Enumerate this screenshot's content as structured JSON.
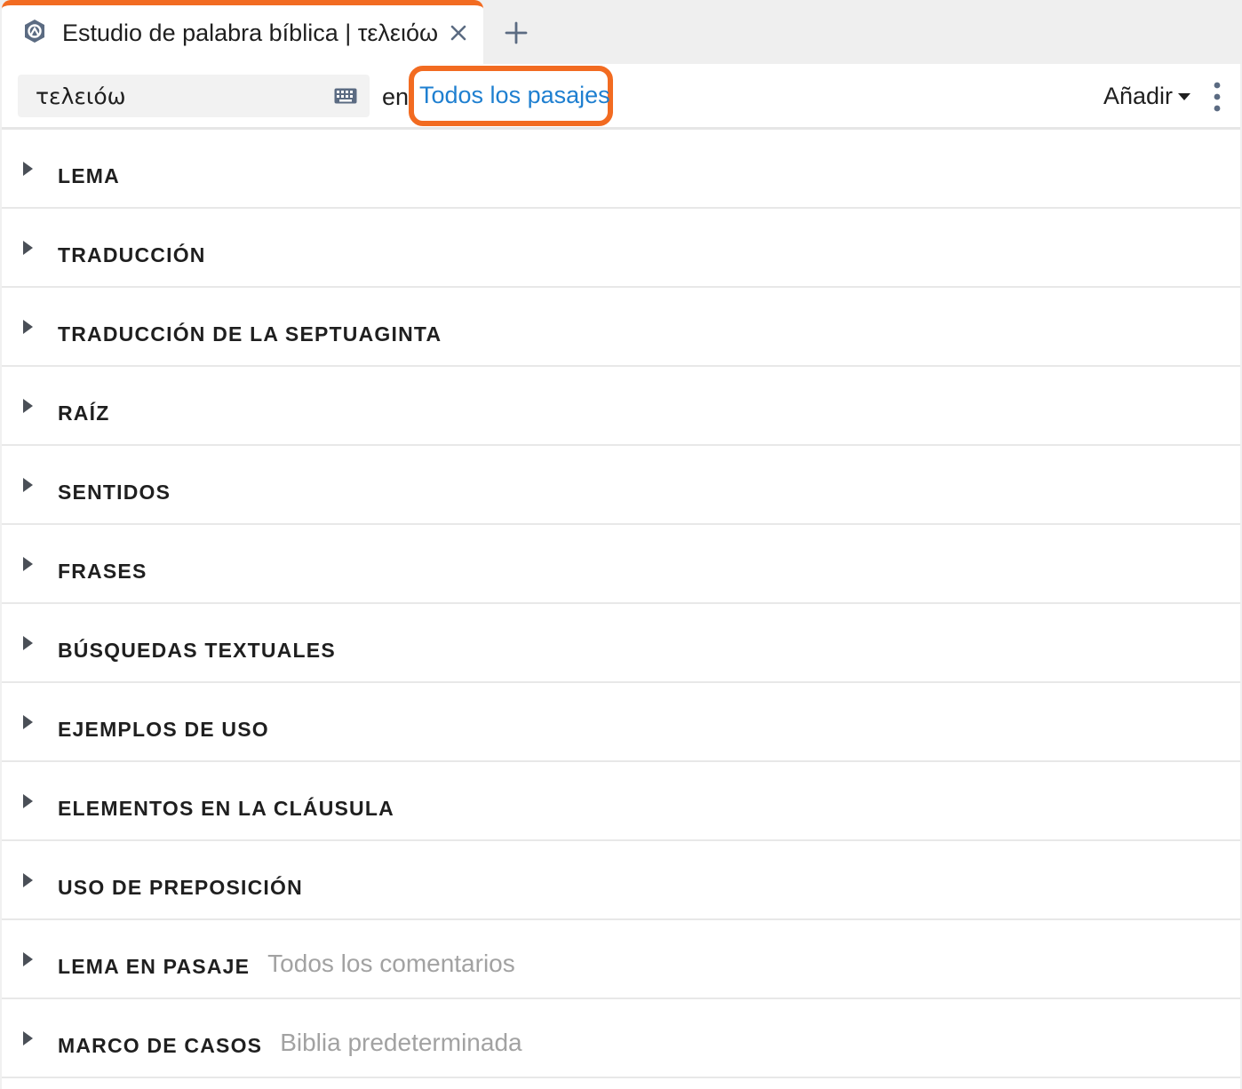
{
  "tab": {
    "title": "Estudio de palabra bíblica | τελειόω"
  },
  "toolbar": {
    "search_value": "τελειόω",
    "in_label": "en",
    "passages_link": "Todos los pasajes",
    "add_label": "Añadir"
  },
  "sections": [
    {
      "label": "LEMA",
      "hint": ""
    },
    {
      "label": "TRADUCCIÓN",
      "hint": ""
    },
    {
      "label": "TRADUCCIÓN DE LA SEPTUAGINTA",
      "hint": ""
    },
    {
      "label": "RAÍZ",
      "hint": ""
    },
    {
      "label": "SENTIDOS",
      "hint": ""
    },
    {
      "label": "FRASES",
      "hint": ""
    },
    {
      "label": "BÚSQUEDAS TEXTUALES",
      "hint": ""
    },
    {
      "label": "EJEMPLOS DE USO",
      "hint": ""
    },
    {
      "label": "ELEMENTOS EN LA CLÁUSULA",
      "hint": ""
    },
    {
      "label": "USO DE PREPOSICIÓN",
      "hint": ""
    },
    {
      "label": "LEMA EN PASAJE",
      "hint": "Todos los comentarios"
    },
    {
      "label": "MARCO DE CASOS",
      "hint": "Biblia predeterminada"
    }
  ],
  "colors": {
    "accent_orange": "#f26b21",
    "link_blue": "#1e7fd0",
    "hint_gray": "#a2a2a2"
  },
  "icons": {
    "tab_logo": "logos-app-icon",
    "close": "close-icon",
    "add_tab": "plus-icon",
    "keyboard": "keyboard-icon",
    "dropdown": "caret-down-icon",
    "more": "vertical-ellipsis-icon",
    "expand": "triangle-right-icon"
  }
}
